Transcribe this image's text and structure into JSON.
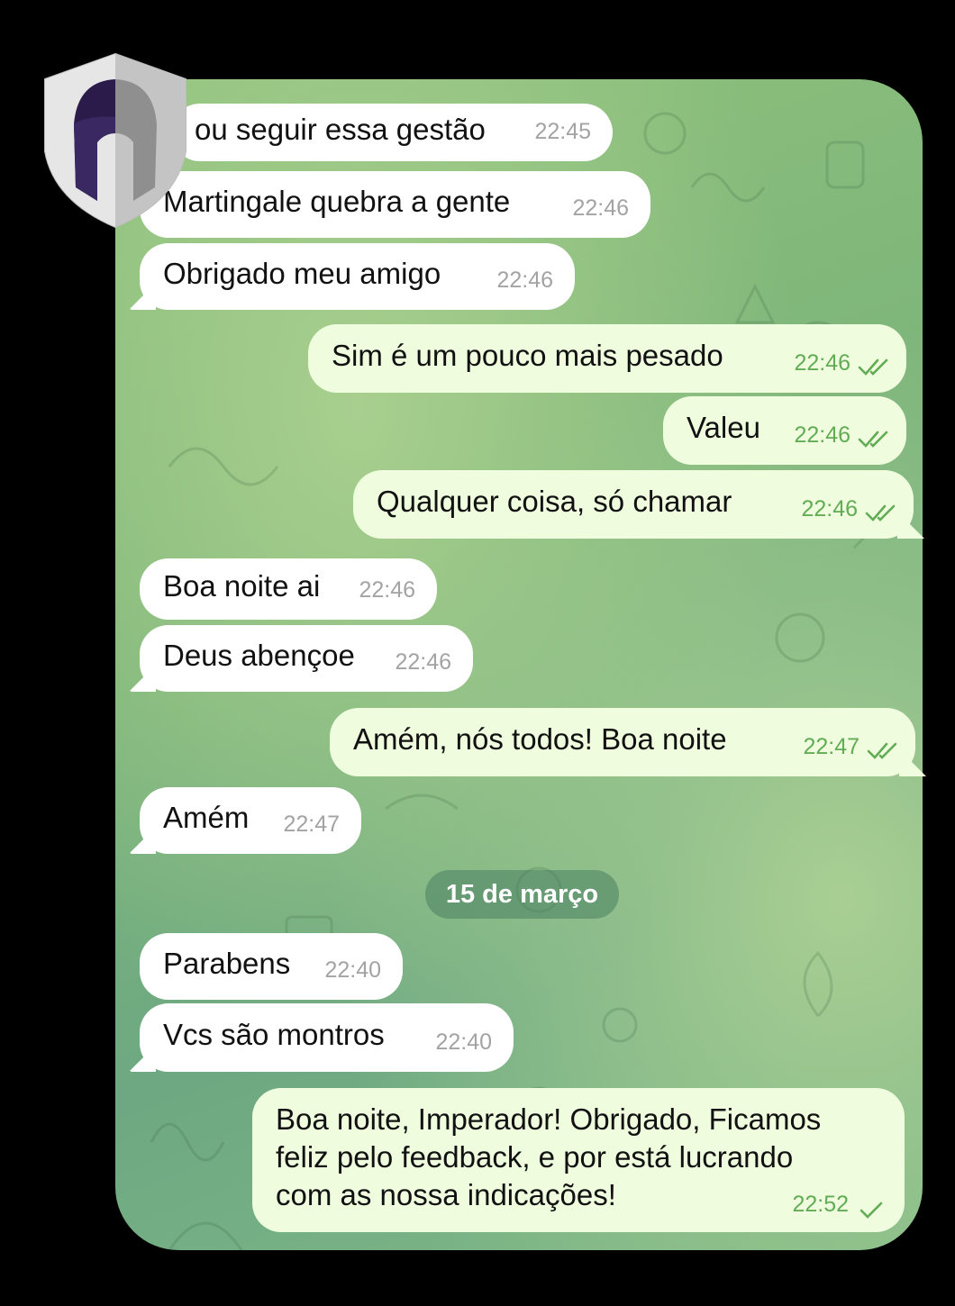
{
  "messages": [
    {
      "text": "ou seguir essa gestão",
      "time": "22:45",
      "dir": "in"
    },
    {
      "text": "Martingale quebra a gente",
      "time": "22:46",
      "dir": "in"
    },
    {
      "text": "Obrigado meu amigo",
      "time": "22:46",
      "dir": "in"
    },
    {
      "text": "Sim é um pouco mais pesado",
      "time": "22:46",
      "dir": "out"
    },
    {
      "text": "Valeu",
      "time": "22:46",
      "dir": "out"
    },
    {
      "text": "Qualquer coisa, só chamar",
      "time": "22:46",
      "dir": "out"
    },
    {
      "text": "Boa noite ai",
      "time": "22:46",
      "dir": "in"
    },
    {
      "text": "Deus abençoe",
      "time": "22:46",
      "dir": "in"
    },
    {
      "text": "Amém, nós todos! Boa noite",
      "time": "22:47",
      "dir": "out"
    },
    {
      "text": "Amém",
      "time": "22:47",
      "dir": "in"
    },
    {
      "text": "Parabens",
      "time": "22:40",
      "dir": "in"
    },
    {
      "text": "Vcs são montros",
      "time": "22:40",
      "dir": "in"
    },
    {
      "text": "Boa noite, Imperador! Obrigado, Ficamos",
      "time": "22:52",
      "dir": "out"
    }
  ],
  "last_message_lines": [
    "Boa noite, Imperador! Obrigado, Ficamos",
    "feliz pelo feedback, e por está lucrando",
    "com as nossa indicações!"
  ],
  "date_separator": "15 de março",
  "colors": {
    "incoming_bubble": "#ffffff",
    "outgoing_bubble": "#effdde",
    "outgoing_time": "#62ac55",
    "incoming_time": "#a3a3a3",
    "date_pill": "#4d8a63"
  },
  "icons": {
    "logo": "spartan-helmet-shield-icon",
    "read_receipt": "double-check-icon",
    "sent_receipt": "single-check-icon"
  }
}
